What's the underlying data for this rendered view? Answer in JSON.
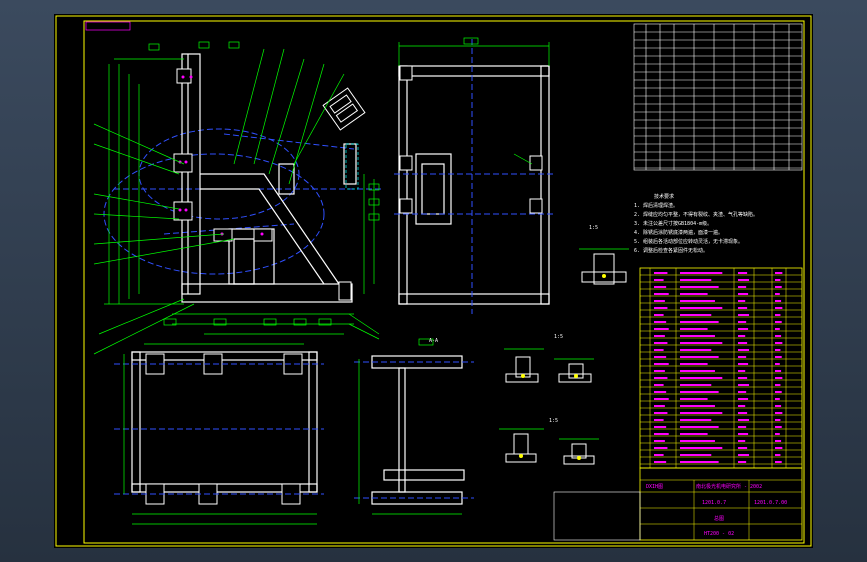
{
  "colors": {
    "background": "#000000",
    "frame": "#ffff00",
    "structure": "#ffffff",
    "dimension": "#00ff00",
    "centerline": "#3050ff",
    "annotation": "#ff00ff",
    "hidden": "#00ffff",
    "window_gradient_top": "#3b4a5e",
    "window_gradient_bottom": "#26313f"
  },
  "title_block": {
    "company": "DXIH图",
    "project": "南北极光机电研究所 - 2002",
    "sheet_label": "总图",
    "drawing_no_left": "1201.0.7",
    "drawing_no_right": "1201.0.7.00",
    "material_ref": "HT200 - 02"
  },
  "view_labels": {
    "section_a": "A-A",
    "detail_1": "1:5",
    "detail_2": "1:5",
    "detail_3": "1:5"
  },
  "notes": {
    "title": "技术要求",
    "lines": [
      "1. 焊后清理焊渣。",
      "2. 焊缝应均匀平整，不得有裂纹、夹渣、气孔等缺陷。",
      "3. 未注公差尺寸按GB1804-m级。",
      "4. 除锈后涂防锈底漆两遍，面漆一遍。",
      "5. 组装后各活动部位应转动灵活，无卡滞现象。",
      "6. 调整后检查各紧固件无松动。"
    ]
  },
  "icons": {
    "screen_bg": "gradient-desktop"
  }
}
